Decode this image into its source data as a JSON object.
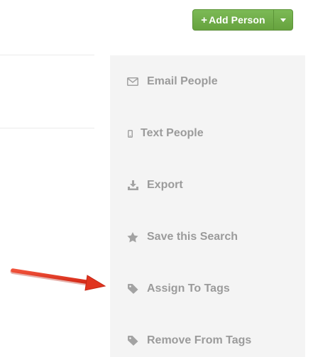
{
  "header": {
    "add_person_label": "Add Person",
    "add_person_plus": "+"
  },
  "actions": [
    {
      "label": "Email People",
      "icon": "envelope-icon"
    },
    {
      "label": "Text People",
      "icon": "mobile-phone-icon"
    },
    {
      "label": "Export",
      "icon": "download-icon"
    },
    {
      "label": "Save this Search",
      "icon": "star-icon"
    },
    {
      "label": "Assign To Tags",
      "icon": "tag-icon"
    },
    {
      "label": "Remove From Tags",
      "icon": "tag-icon"
    }
  ],
  "colors": {
    "primary_button": "#6aa743",
    "panel_background": "#f4f4f4",
    "menu_text": "#9b9b9b",
    "annotation_arrow": "#e5341f"
  }
}
